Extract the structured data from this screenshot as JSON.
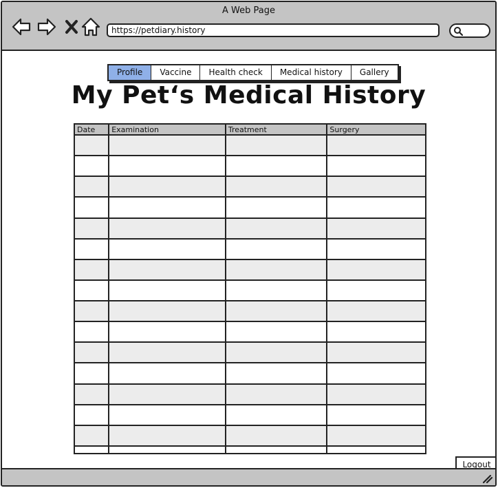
{
  "window": {
    "title": "A Web Page"
  },
  "browser": {
    "url": "https://petdiary.history",
    "back_icon": "arrow-left-icon",
    "forward_icon": "arrow-right-icon",
    "stop_icon": "close-icon",
    "home_icon": "home-icon",
    "search_icon": "search-icon"
  },
  "tabs": [
    {
      "label": "Profile",
      "active": true
    },
    {
      "label": "Vaccine",
      "active": false
    },
    {
      "label": "Health check",
      "active": false
    },
    {
      "label": "Medical history",
      "active": false
    },
    {
      "label": "Gallery",
      "active": false
    }
  ],
  "page": {
    "title": "My Pet‘s Medical History"
  },
  "table": {
    "columns": [
      "Date",
      "Examination",
      "Treatment",
      "Surgery"
    ],
    "row_count": 15,
    "rows": []
  },
  "footer": {
    "logout_label": "Logout"
  },
  "colors": {
    "chrome": "#c4c4c4",
    "active_tab": "#8fb0e8",
    "stripe": "#ececec",
    "stroke": "#222222"
  }
}
